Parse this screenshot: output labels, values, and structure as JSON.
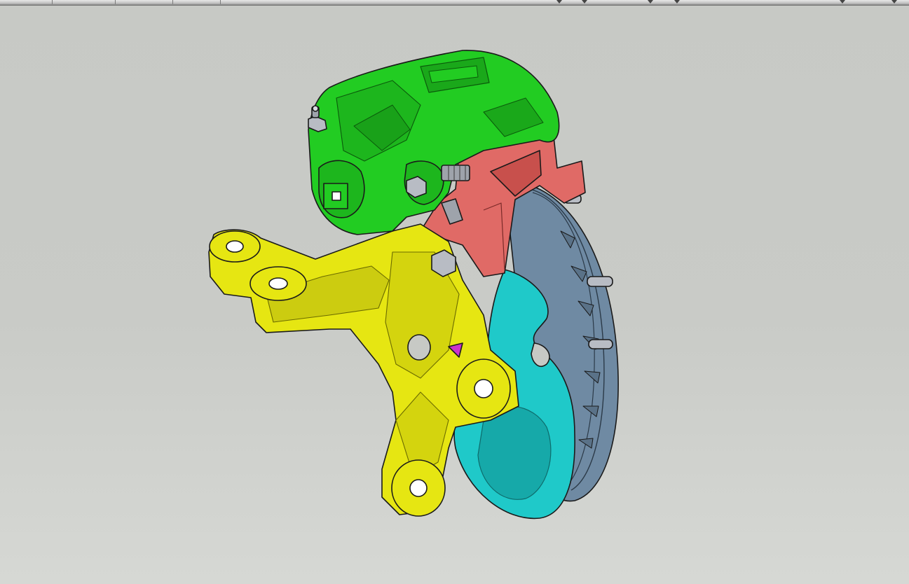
{
  "viewport": {
    "background_top": "#c7c9c5",
    "background_bottom": "#d6d8d4"
  },
  "model": {
    "parts": [
      {
        "name": "brake-caliper",
        "color": "#22cc22"
      },
      {
        "name": "caliper-bracket",
        "color": "#e06a66"
      },
      {
        "name": "steering-knuckle",
        "color": "#e6e612"
      },
      {
        "name": "brake-disc",
        "color": "#6f8aa3"
      },
      {
        "name": "dust-shield",
        "color": "#1fc9c9"
      },
      {
        "name": "fasteners",
        "color": "#b8bcc4"
      }
    ]
  }
}
